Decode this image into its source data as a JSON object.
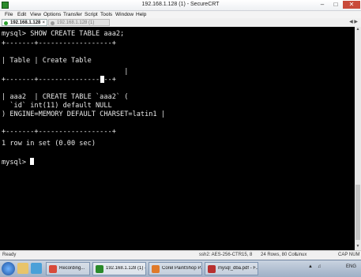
{
  "window": {
    "title": "192.168.1.128 (1) - SecureCRT"
  },
  "menu": [
    "File",
    "Edit",
    "View",
    "Options",
    "Transfer",
    "Script",
    "Tools",
    "Window",
    "Help"
  ],
  "tabs": [
    {
      "label": "192.168.1.128",
      "active": true
    },
    {
      "label": "192.168.1.128 (1)",
      "active": false
    }
  ],
  "terminal": {
    "lines": [
      "mysql> SHOW CREATE TABLE aaa2;",
      "+-------+------------------+",
      "| Table | Create Table",
      "                              |",
      "+-------+------------------+",
      "| aaa2  | CREATE TABLE `aaa2` (",
      "  `id` int(11) default NULL",
      ") ENGINE=MEMORY DEFAULT CHARSET=latin1 |",
      "+-------+------------------+",
      "1 row in set (0.00 sec)",
      "",
      "mysql> "
    ]
  },
  "status": {
    "left": "Ready",
    "cipher": "ssh2: AES-256-CTR",
    "position": "15,  8",
    "size": "24 Rows, 80 Cols",
    "os": "Linux",
    "caps": "CAP NUM"
  },
  "taskbar": {
    "items": [
      "Recording...",
      "192.168.1.128 (1) - S...",
      "Corel PaintShop P...",
      "mysql_dba.pdf - F..."
    ],
    "lang": "ENG"
  },
  "colors": {
    "terminal_bg": "#000000",
    "terminal_fg": "#e8e8e8",
    "close_btn": "#c94a3a"
  }
}
